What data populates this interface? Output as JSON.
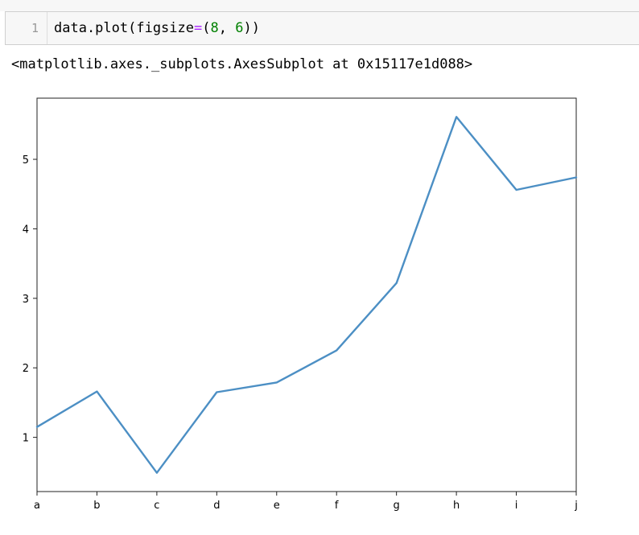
{
  "cell": {
    "line_number": "1",
    "code": {
      "t1": "data.plot(figsize",
      "t2": "=",
      "t3": "(",
      "t4": "8",
      "t5": ", ",
      "t6": "6",
      "t7": "))"
    }
  },
  "output": {
    "repr": "<matplotlib.axes._subplots.AxesSubplot at 0x15117e1d088>"
  },
  "colors": {
    "line": "#4c8fc4",
    "axes": "#222222",
    "code_number": "#008000",
    "code_operator": "#aa22ff"
  },
  "chart_data": {
    "type": "line",
    "title": "",
    "xlabel": "",
    "ylabel": "",
    "categories": [
      "a",
      "b",
      "c",
      "d",
      "e",
      "f",
      "g",
      "h",
      "i",
      "j"
    ],
    "series": [
      {
        "values": [
          1.15,
          1.66,
          0.49,
          1.65,
          1.79,
          2.25,
          3.22,
          5.61,
          4.56,
          4.74
        ]
      }
    ],
    "ylim": [
      0.22,
      5.88
    ],
    "yticks": [
      1,
      2,
      3,
      4,
      5
    ],
    "grid": false,
    "legend": "none"
  }
}
